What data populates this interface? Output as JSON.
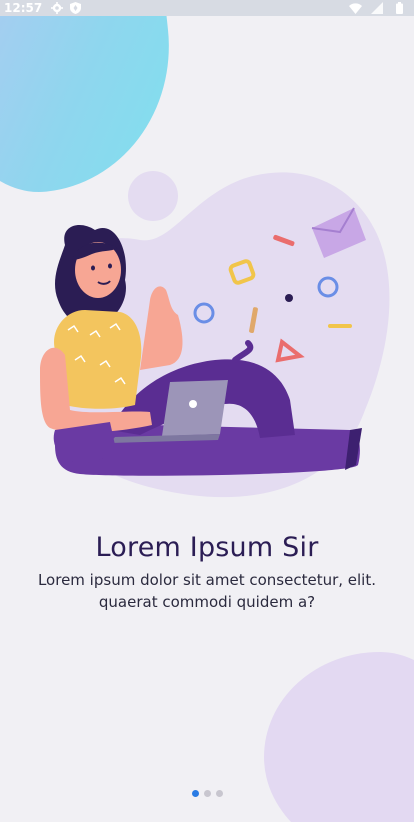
{
  "status_bar": {
    "time": "12:57",
    "left_icons": [
      "gear-icon",
      "shield-icon"
    ],
    "right_icons": [
      "wifi-icon",
      "signal-icon",
      "battery-icon"
    ]
  },
  "onboarding": {
    "title": "Lorem Ipsum Sir",
    "body_line1": "Lorem ipsum dolor sit amet consectetur,  elit.",
    "body_line2": "quaerat commodi quidem a?"
  },
  "pager": {
    "page_count": 3,
    "current_page": 1,
    "active_color": "#2a7be4",
    "inactive_color": "#c8c6cf"
  },
  "colors": {
    "background": "#f1f0f4",
    "title": "#2b1d54",
    "accent_purple": "#6a3aa3"
  }
}
